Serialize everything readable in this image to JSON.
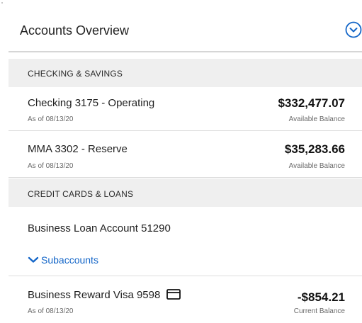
{
  "header": {
    "title": "Accounts Overview",
    "toggle_icon": "chevron-down-circle-icon",
    "accent_color": "#1466c8"
  },
  "sections": [
    {
      "label": "CHECKING & SAVINGS",
      "accounts": [
        {
          "name": "Checking 3175 - Operating",
          "as_of": "As of 08/13/20",
          "amount": "$332,477.07",
          "amount_label": "Available Balance"
        },
        {
          "name": "MMA 3302 - Reserve",
          "as_of": "As of 08/13/20",
          "amount": "$35,283.66",
          "amount_label": "Available Balance"
        }
      ]
    },
    {
      "label": "CREDIT CARDS & LOANS",
      "accounts": [
        {
          "name": "Business Loan Account 51290",
          "subaccounts_link": "Subaccounts"
        },
        {
          "name": "Business Reward Visa 9598",
          "icon": "credit-card-icon",
          "as_of": "As of 08/13/20",
          "amount": "-$854.21",
          "amount_label": "Current Balance"
        }
      ]
    }
  ]
}
